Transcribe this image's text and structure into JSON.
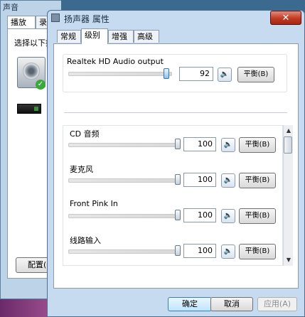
{
  "back_window": {
    "title": "声音",
    "tabs": [
      "播放",
      "录"
    ],
    "label": "选择以下播",
    "config_button": "配置(C"
  },
  "window": {
    "title": "扬声器 属性",
    "close_glyph": "✕"
  },
  "tabs": [
    {
      "label": "常规"
    },
    {
      "label": "级别",
      "active": true
    },
    {
      "label": "增强"
    },
    {
      "label": "高级"
    }
  ],
  "master": {
    "label": "Realtek HD Audio output",
    "value": "92",
    "level": 0.92,
    "mute_icon": "speaker-icon",
    "balance": "平衡(B)"
  },
  "channels": [
    {
      "label": "CD 音频",
      "value": "100",
      "level": 1.0,
      "balance": "平衡(B)"
    },
    {
      "label": "麦克风",
      "value": "100",
      "level": 1.0,
      "balance": "平衡(B)"
    },
    {
      "label": "Front Pink In",
      "value": "100",
      "level": 1.0,
      "balance": "平衡(B)"
    },
    {
      "label": "线路输入",
      "value": "100",
      "level": 1.0,
      "balance": "平衡(B)"
    }
  ],
  "buttons": {
    "ok": "确定",
    "cancel": "取消",
    "apply": "应用(A)"
  }
}
